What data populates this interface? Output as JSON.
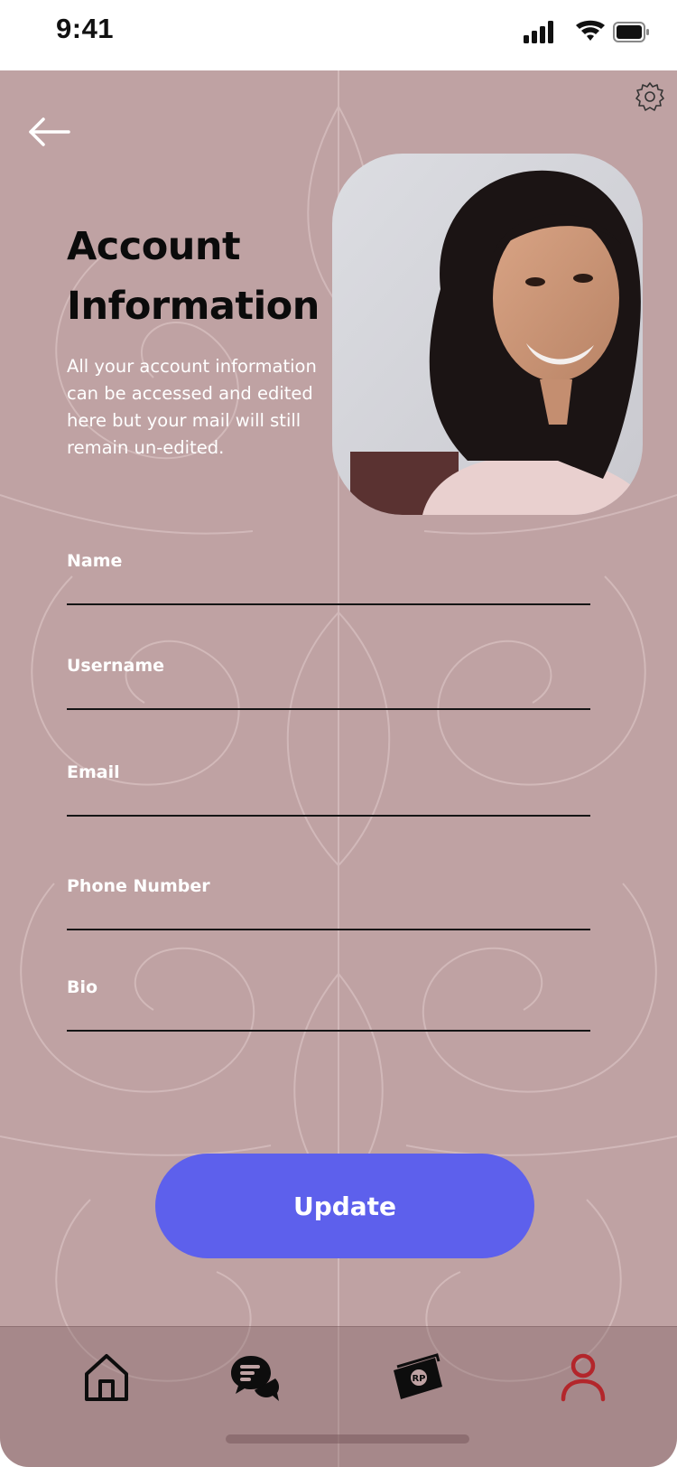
{
  "status_bar": {
    "time": "9:41"
  },
  "page": {
    "title": "Account Information",
    "description": "All your account information can be accessed and edited here but your mail will still remain un-edited."
  },
  "icons": {
    "back": "arrow-left-icon",
    "settings": "gear-icon",
    "nav_home": "home-icon",
    "nav_chat": "chat-icon",
    "nav_money": "money-icon",
    "nav_profile": "profile-icon"
  },
  "form": {
    "fields": [
      {
        "label": "Name",
        "value": ""
      },
      {
        "label": "Username",
        "value": ""
      },
      {
        "label": "Email",
        "value": ""
      },
      {
        "label": "Phone Number",
        "value": ""
      },
      {
        "label": "Bio",
        "value": ""
      }
    ],
    "submit_label": "Update"
  },
  "bottom_nav": {
    "money_badge": "RP",
    "active_item": "profile"
  },
  "colors": {
    "background": "#bfa2a3",
    "accent": "#5d60ec",
    "active_nav": "#b3262b",
    "title_text": "#0b0b0b",
    "label_text": "#ffffff"
  }
}
